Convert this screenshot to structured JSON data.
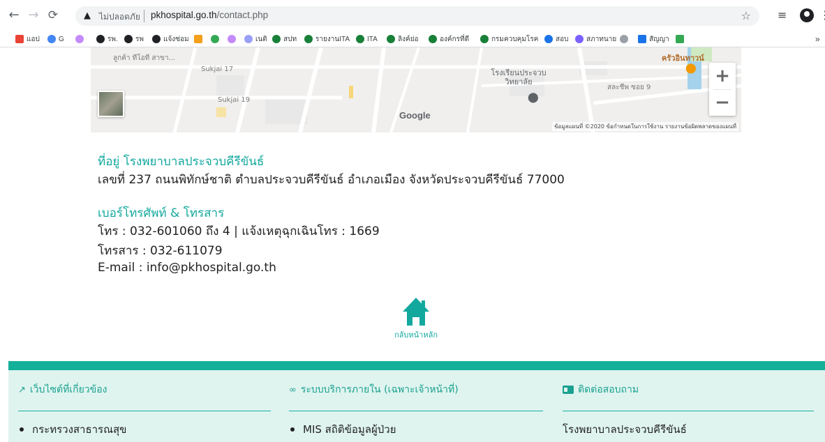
{
  "browser": {
    "security_label": "ไม่ปลอดภัย",
    "url_domain": "pkhospital.go.th",
    "url_path": "/contact.php",
    "bookmarks": [
      {
        "label": "แอป",
        "color": "#ea4335",
        "icon": "apps-grid-icon"
      },
      {
        "label": "G",
        "color": "#4285f4",
        "icon": "google-icon"
      },
      {
        "label": "",
        "color": "#c58af9",
        "icon": "cool-icon"
      },
      {
        "label": "รพ.",
        "color": "#202124",
        "icon": "globe-icon"
      },
      {
        "label": "รพ",
        "color": "#202124",
        "icon": "globe-icon"
      },
      {
        "label": "แจ้งซ่อม",
        "color": "#202124",
        "icon": "globe-icon"
      },
      {
        "label": "",
        "color": "#f4a01b",
        "icon": "box-icon"
      },
      {
        "label": "",
        "color": "#34a853",
        "icon": "e-icon"
      },
      {
        "label": "",
        "color": "#c58af9",
        "icon": "feather-icon"
      },
      {
        "label": "เนติ",
        "color": "#9aa0f6",
        "icon": "circle-icon"
      },
      {
        "label": "สปท",
        "color": "#188038",
        "icon": "moph-icon"
      },
      {
        "label": "รายงานITA",
        "color": "#188038",
        "icon": "moph-icon"
      },
      {
        "label": "ITA",
        "color": "#188038",
        "icon": "moph-icon"
      },
      {
        "label": "ลิงค์ย่อ",
        "color": "#188038",
        "icon": "moph-icon"
      },
      {
        "label": "องค์กรที่ดี",
        "color": "#188038",
        "icon": "moph-icon"
      },
      {
        "label": "กรมควบคุมโรค",
        "color": "#188038",
        "icon": "moph-icon"
      },
      {
        "label": "สอบ",
        "color": "#1a73e8",
        "icon": "u-icon"
      },
      {
        "label": "สภาทนาย",
        "color": "#7b61ff",
        "icon": "seal-icon"
      },
      {
        "label": "",
        "color": "#9aa0a6",
        "icon": "seal2-icon"
      },
      {
        "label": "สัญญา",
        "color": "#1a73e8",
        "icon": "calendar-icon"
      },
      {
        "label": "",
        "color": "#34a853",
        "icon": "xcolor-icon"
      }
    ],
    "more_bookmarks": "»"
  },
  "map": {
    "labels": {
      "place_top": "ลูกค้า ทีโอที สาขา...",
      "sukjai17": "Sukjai 17",
      "sukjai19": "Sukjai 19",
      "school": "โรงเรียนประจวบ\nวิทยาลัย",
      "restaurant": "ครัวอินทาวน์",
      "soi9": "สละชีพ ซอย 9",
      "google": "Google",
      "attribution": "ข้อมูลแผนที่ ©2020   ข้อกำหนดในการใช้งาน   รายงานข้อผิดพลาดของแผนที่"
    },
    "zoom_in": "+",
    "zoom_out": "−"
  },
  "contact": {
    "address_heading": "ที่อยู่ โรงพยาบาลประจวบคีรีขันธ์",
    "address_line": "เลขที่ 237 ถนนพิทักษ์ชาติ ตำบลประจวบคีรีขันธ์ อำเภอเมือง จังหวัดประจวบคีรีขันธ์ 77000",
    "phone_heading": "เบอร์โทรศัพท์ & โทรสาร",
    "phone_line": "โทร : 032-601060 ถึง 4 | แจ้งเหตุฉุกเฉินโทร : 1669",
    "fax_line": "โทรสาร : 032-611079",
    "email_line": "E-mail : info@pkhospital.go.th",
    "home_label": "กลับหน้าหลัก"
  },
  "footer": {
    "col1_title": "เว็บไซต์ที่เกี่ยวข้อง",
    "col1_item": "กระทรวงสาธารณสุข",
    "col2_title": "ระบบบริการภายใน (เฉพาะเจ้าหน้าที่)",
    "col2_item": "MIS สถิติข้อมูลผู้ป่วย",
    "col3_title": "ติดต่อสอบถาม",
    "col3_item": "โรงพยาบาลประจวบคีรีขันธ์"
  },
  "colors": {
    "accent": "#13a89e",
    "footer_bg": "#dff4ef",
    "footer_bar": "#14b09a"
  }
}
